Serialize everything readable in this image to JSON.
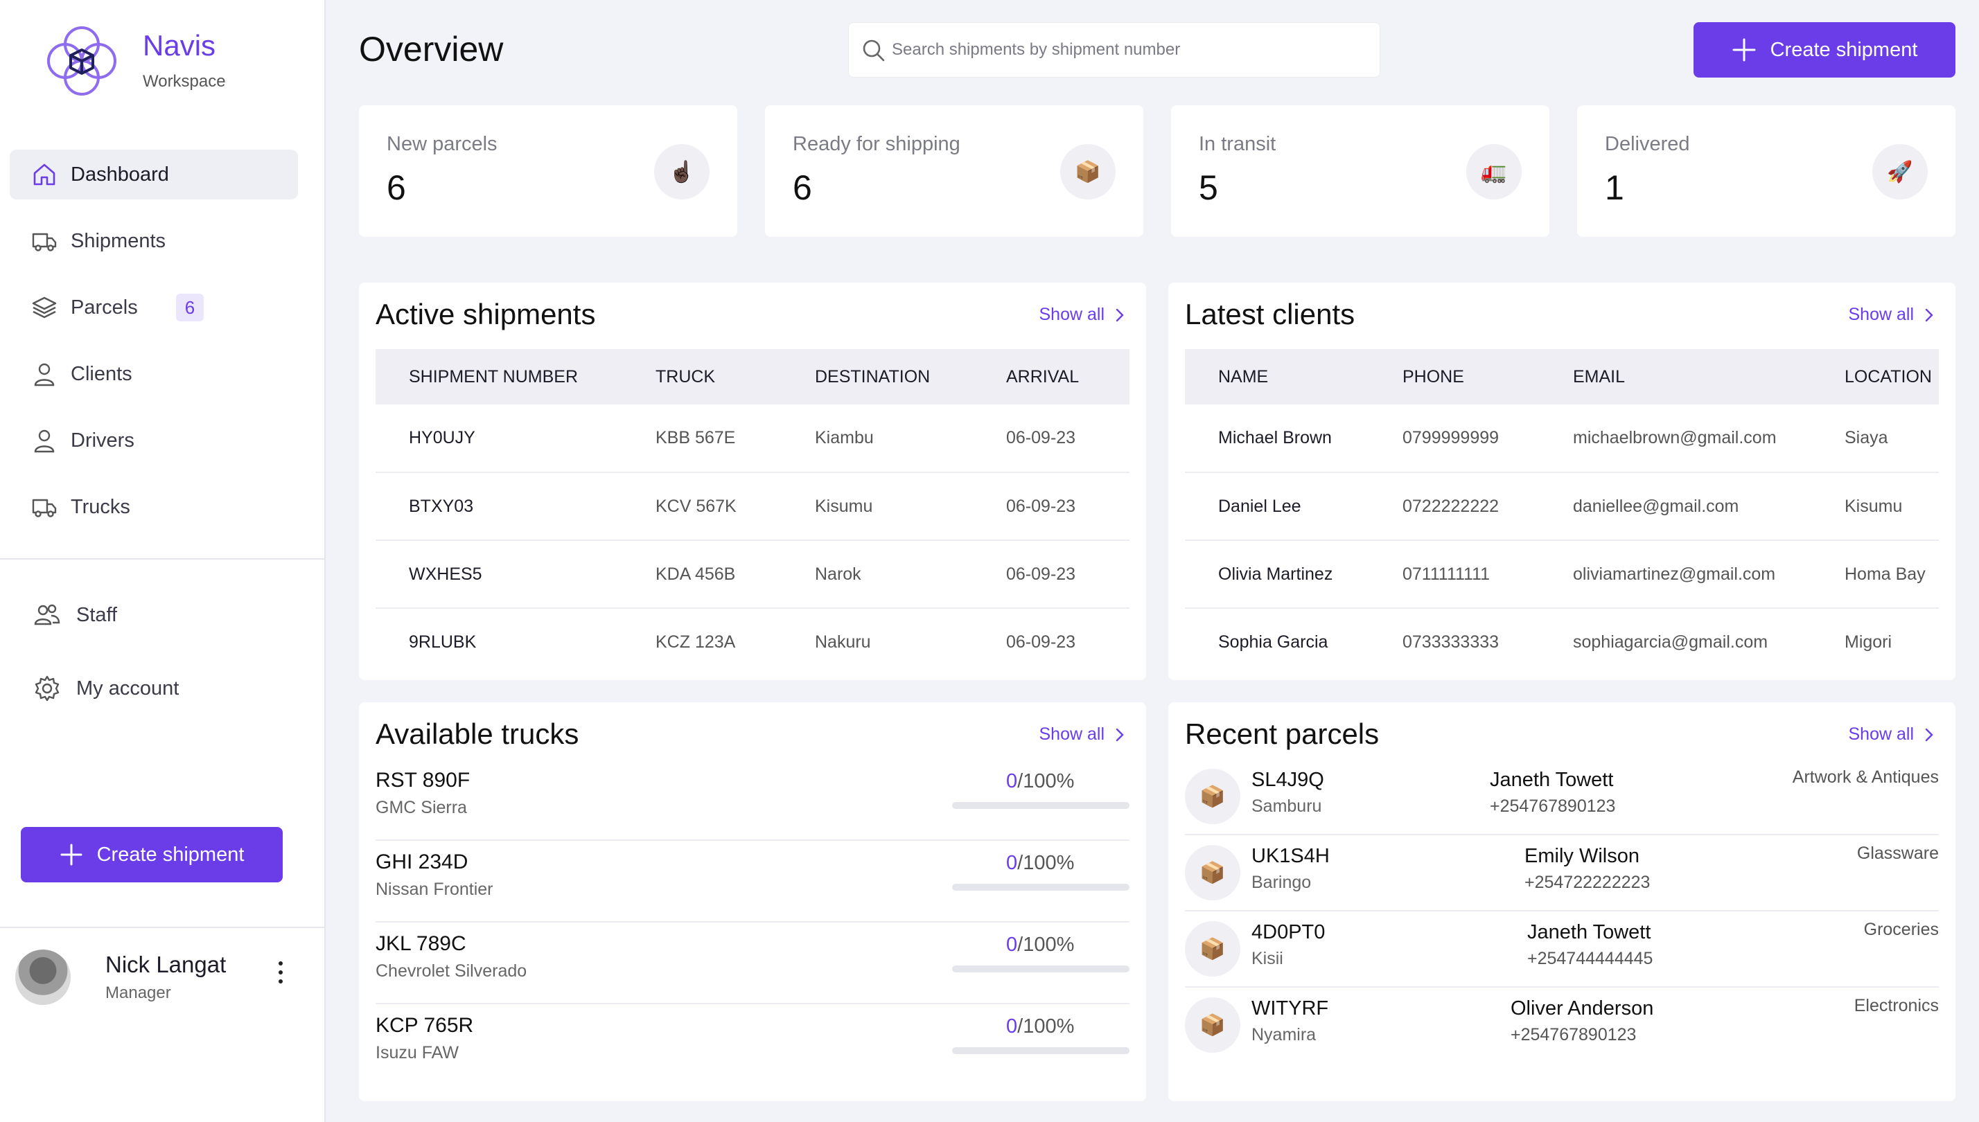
{
  "brand": {
    "name": "Navis",
    "subtitle": "Workspace"
  },
  "sidebar": {
    "nav": [
      {
        "label": "Dashboard",
        "icon": "home-icon",
        "active": true
      },
      {
        "label": "Shipments",
        "icon": "truck-icon"
      },
      {
        "label": "Parcels",
        "icon": "layers-icon",
        "badge": "6"
      },
      {
        "label": "Clients",
        "icon": "user-icon"
      },
      {
        "label": "Drivers",
        "icon": "user-icon"
      },
      {
        "label": "Trucks",
        "icon": "truck-icon"
      }
    ],
    "secondary": [
      {
        "label": "Staff",
        "icon": "users-icon"
      },
      {
        "label": "My account",
        "icon": "gear-icon"
      }
    ],
    "create_label": "Create shipment",
    "user": {
      "name": "Nick Langat",
      "role": "Manager"
    }
  },
  "header": {
    "title": "Overview",
    "search_placeholder": "Search shipments by shipment number",
    "create_label": "Create shipment"
  },
  "stats": [
    {
      "label": "New parcels",
      "value": "6",
      "emoji": "☝🏿"
    },
    {
      "label": "Ready for shipping",
      "value": "6",
      "emoji": "📦"
    },
    {
      "label": "In transit",
      "value": "5",
      "emoji": "🚛"
    },
    {
      "label": "Delivered",
      "value": "1",
      "emoji": "🚀"
    }
  ],
  "active_shipments": {
    "title": "Active shipments",
    "show_all": "Show all",
    "columns": [
      "SHIPMENT NUMBER",
      "TRUCK",
      "DESTINATION",
      "ARRIVAL"
    ],
    "rows": [
      [
        "HY0UJY",
        "KBB 567E",
        "Kiambu",
        "06-09-23"
      ],
      [
        "BTXY03",
        "KCV 567K",
        "Kisumu",
        "06-09-23"
      ],
      [
        "WXHES5",
        "KDA 456B",
        "Narok",
        "06-09-23"
      ],
      [
        "9RLUBK",
        "KCZ 123A",
        "Nakuru",
        "06-09-23"
      ]
    ]
  },
  "latest_clients": {
    "title": "Latest clients",
    "show_all": "Show all",
    "columns": [
      "NAME",
      "PHONE",
      "EMAIL",
      "LOCATION"
    ],
    "rows": [
      [
        "Michael Brown",
        "0799999999",
        "michaelbrown@gmail.com",
        "Siaya"
      ],
      [
        "Daniel Lee",
        "0722222222",
        "daniellee@gmail.com",
        "Kisumu"
      ],
      [
        "Olivia Martinez",
        "0711111111",
        "oliviamartinez@gmail.com",
        "Homa Bay"
      ],
      [
        "Sophia Garcia",
        "0733333333",
        "sophiagarcia@gmail.com",
        "Migori"
      ]
    ]
  },
  "available_trucks": {
    "title": "Available trucks",
    "show_all": "Show all",
    "items": [
      {
        "plate": "RST 890F",
        "model": "GMC Sierra",
        "load": "0",
        "capacity": "/100%",
        "fill": 0
      },
      {
        "plate": "GHI 234D",
        "model": "Nissan Frontier",
        "load": "0",
        "capacity": "/100%",
        "fill": 0
      },
      {
        "plate": "JKL 789C",
        "model": "Chevrolet Silverado",
        "load": "0",
        "capacity": "/100%",
        "fill": 0
      },
      {
        "plate": "KCP 765R",
        "model": "Isuzu FAW",
        "load": "0",
        "capacity": "/100%",
        "fill": 0
      }
    ]
  },
  "recent_parcels": {
    "title": "Recent parcels",
    "show_all": "Show all",
    "items": [
      {
        "code": "SL4J9Q",
        "location": "Samburu",
        "recipient": "Janeth Towett",
        "phone": "+254767890123",
        "category": "Artwork & Antiques",
        "emoji": "📦"
      },
      {
        "code": "UK1S4H",
        "location": "Baringo",
        "recipient": "Emily Wilson",
        "phone": "+254722222223",
        "category": "Glassware",
        "emoji": "📦"
      },
      {
        "code": "4D0PT0",
        "location": "Kisii",
        "recipient": "Janeth Towett",
        "phone": "+254744444445",
        "category": "Groceries",
        "emoji": "📦"
      },
      {
        "code": "WITYRF",
        "location": "Nyamira",
        "recipient": "Oliver Anderson",
        "phone": "+254767890123",
        "category": "Electronics",
        "emoji": "📦"
      }
    ]
  },
  "colors": {
    "accent": "#6a3de8",
    "background": "#f2f2f9"
  }
}
